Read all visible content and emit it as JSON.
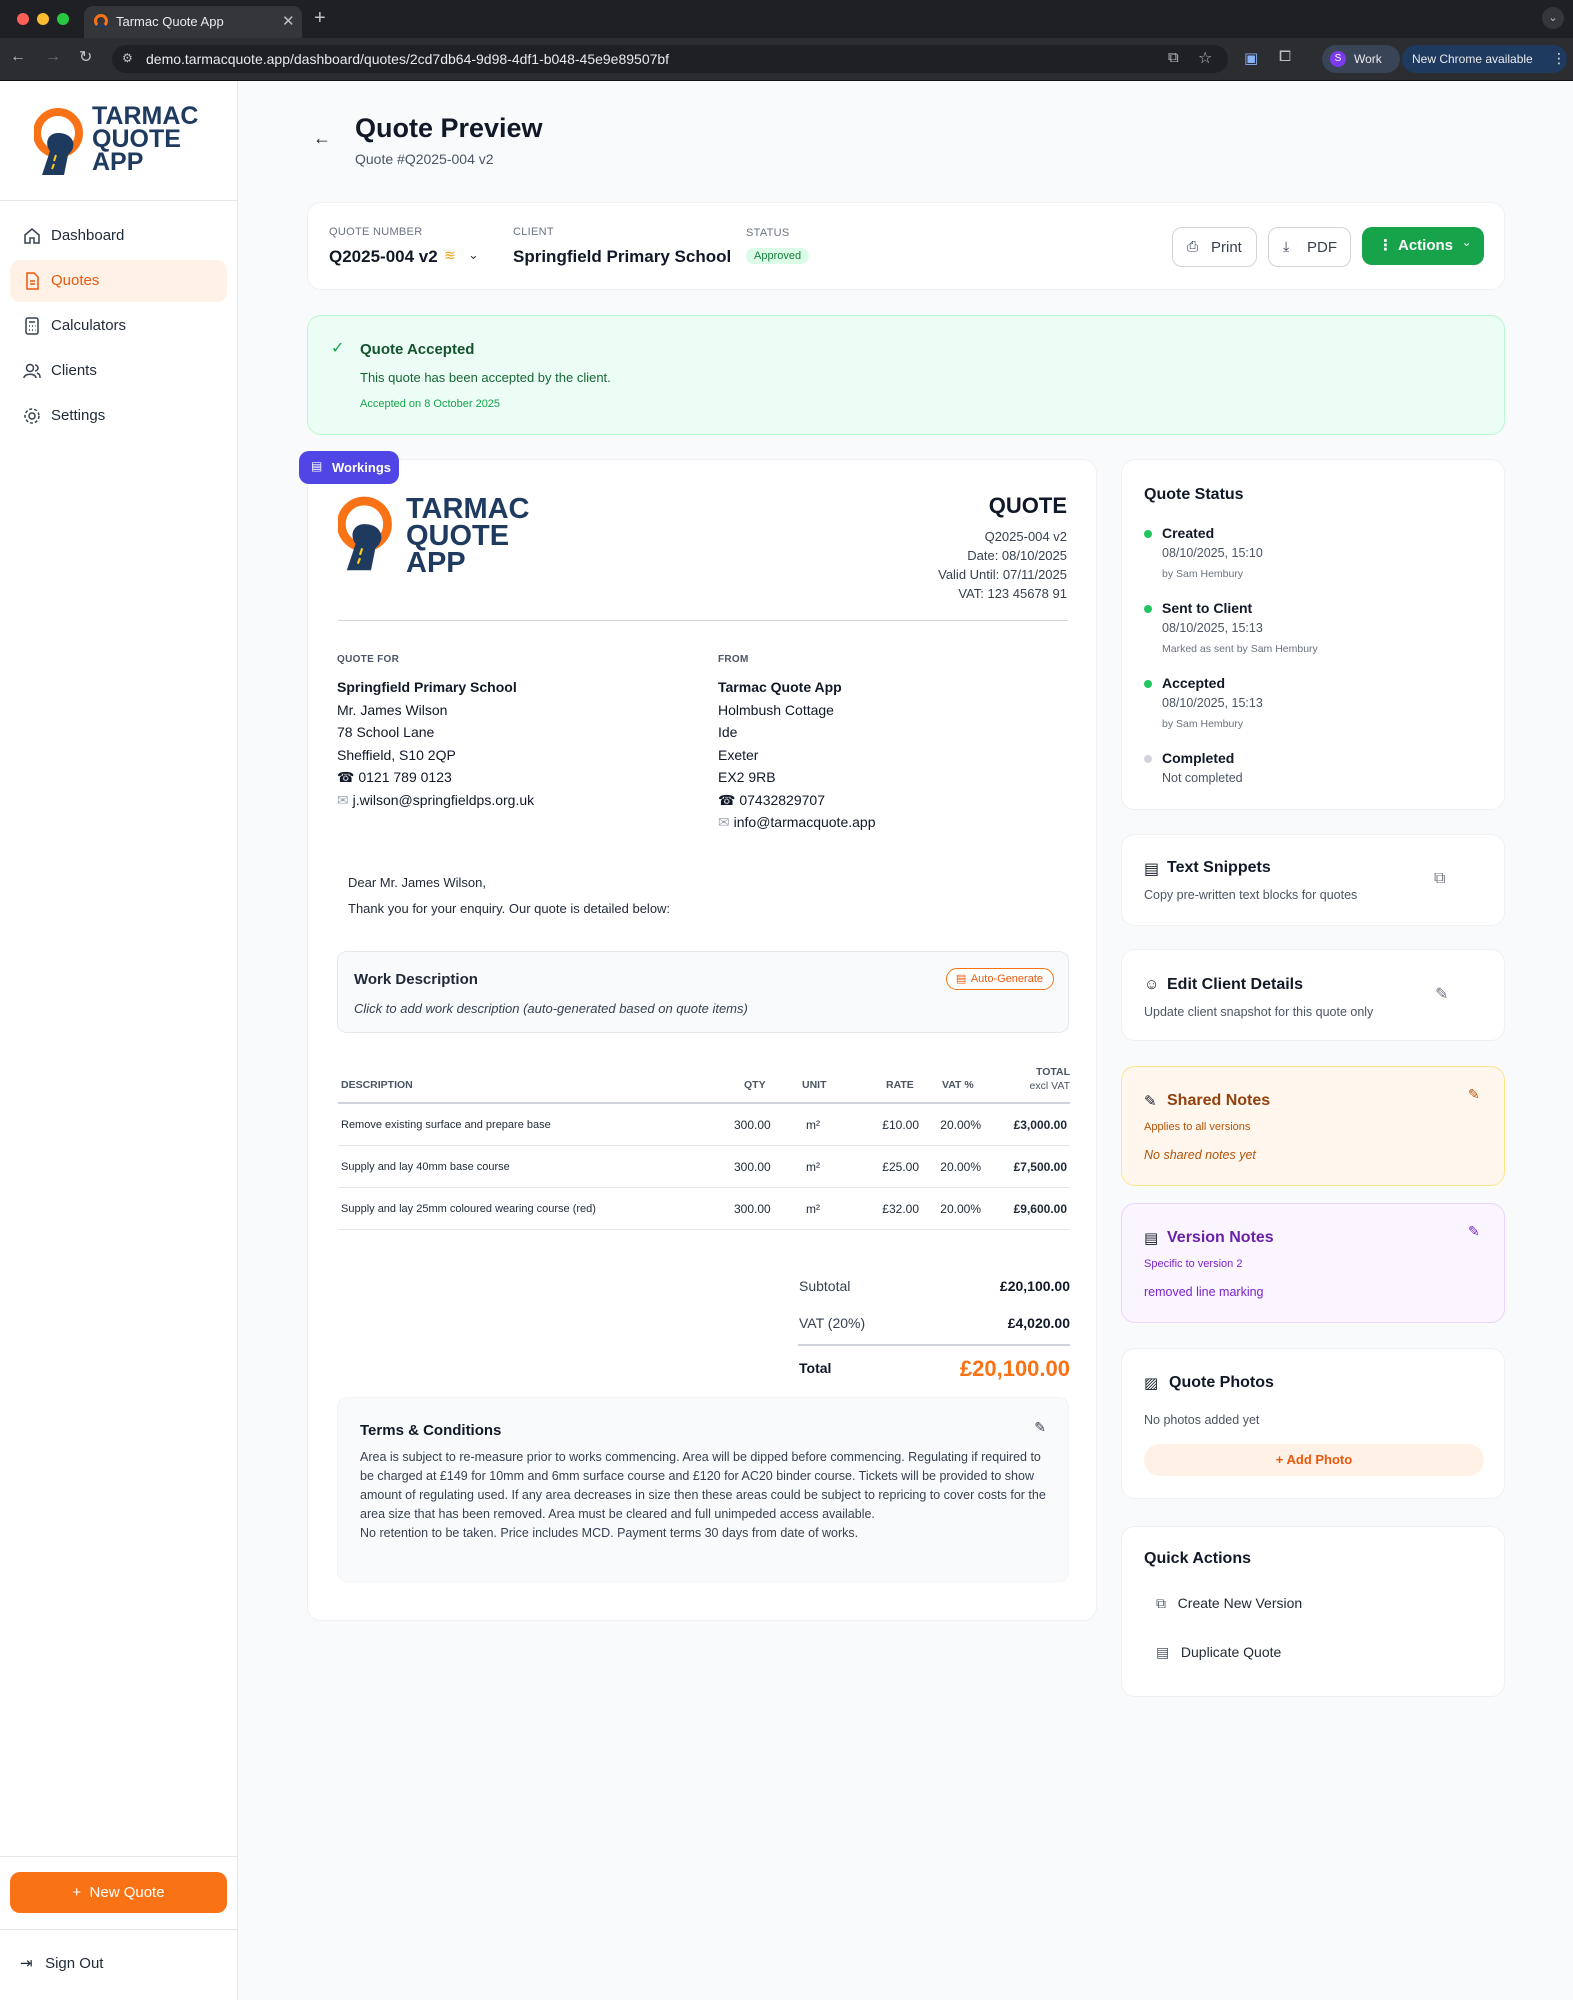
{
  "browser": {
    "tab_title": "Tarmac Quote App",
    "url": "demo.tarmacquote.app/dashboard/quotes/2cd7db64-9d98-4df1-b048-45e9e89507bf",
    "profile": "Work",
    "profile_initial": "S",
    "update_label": "New Chrome available"
  },
  "brand": {
    "line1": "TARMAC",
    "line2": "QUOTE",
    "line3": "APP",
    "primary_color": "#f97316",
    "dark_color": "#1e3a5f"
  },
  "sidebar": {
    "items": [
      {
        "label": "Dashboard",
        "icon": "home-icon"
      },
      {
        "label": "Quotes",
        "icon": "document-icon",
        "active": true
      },
      {
        "label": "Calculators",
        "icon": "calculator-icon"
      },
      {
        "label": "Clients",
        "icon": "users-icon"
      },
      {
        "label": "Settings",
        "icon": "gear-icon"
      }
    ],
    "new_quote": "New Quote",
    "sign_out": "Sign Out"
  },
  "header": {
    "title": "Quote Preview",
    "subtitle": "Quote #Q2025-004 v2"
  },
  "summary": {
    "quote_number_label": "QUOTE NUMBER",
    "quote_number": "Q2025-004 v2",
    "client_label": "CLIENT",
    "client": "Springfield Primary School",
    "status_label": "STATUS",
    "status": "Approved",
    "print": "Print",
    "pdf": "PDF",
    "actions": "Actions"
  },
  "accepted": {
    "title": "Quote Accepted",
    "message": "This quote has been accepted by the client.",
    "date": "Accepted on 8 October 2025"
  },
  "workings": "Workings",
  "document": {
    "heading": "QUOTE",
    "number": "Q2025-004 v2",
    "date": "Date: 08/10/2025",
    "valid_until": "Valid Until: 07/11/2025",
    "vat": "VAT: 123 45678 91",
    "quote_for_label": "QUOTE FOR",
    "quote_for": {
      "name": "Springfield Primary School",
      "contact": "Mr. James Wilson",
      "address1": "78 School Lane",
      "address2": "Sheffield, S10 2QP",
      "phone": "0121 789 0123",
      "email": "j.wilson@springfieldps.org.uk"
    },
    "from_label": "FROM",
    "from": {
      "name": "Tarmac Quote App",
      "line1": "Holmbush Cottage",
      "line2": "Ide",
      "line3": "Exeter",
      "line4": "EX2 9RB",
      "phone": "07432829707",
      "email": "info@tarmacquote.app"
    },
    "greeting": "Dear Mr. James Wilson,",
    "intro": "Thank you for your enquiry. Our quote is detailed below:",
    "work_title": "Work Description",
    "auto_generate": "Auto-Generate",
    "work_placeholder": "Click to add work description (auto-generated based on quote items)",
    "columns": {
      "description": "DESCRIPTION",
      "qty": "QTY",
      "unit": "UNIT",
      "rate": "RATE",
      "vat": "VAT %",
      "total": "TOTAL",
      "total_sub": "excl VAT"
    },
    "items": [
      {
        "description": "Remove existing surface and prepare base",
        "qty": "300.00",
        "unit": "m²",
        "rate": "£10.00",
        "vat": "20.00%",
        "total": "£3,000.00"
      },
      {
        "description": "Supply and lay 40mm base course",
        "qty": "300.00",
        "unit": "m²",
        "rate": "£25.00",
        "vat": "20.00%",
        "total": "£7,500.00"
      },
      {
        "description": "Supply and lay 25mm coloured wearing course (red)",
        "qty": "300.00",
        "unit": "m²",
        "rate": "£32.00",
        "vat": "20.00%",
        "total": "£9,600.00"
      }
    ],
    "subtotal_label": "Subtotal",
    "subtotal": "£20,100.00",
    "vat_label": "VAT (20%)",
    "vat_total": "£4,020.00",
    "total_label": "Total",
    "total": "£20,100.00",
    "terms_title": "Terms & Conditions",
    "terms_p1": "Area is subject to re-measure prior to works commencing. Area will be dipped before commencing. Regulating if required to be charged at £149 for 10mm and 6mm surface course and £120 for AC20 binder course. Tickets will be provided to show amount of regulating used. If any area decreases in size then these areas could be subject to repricing to cover costs for the area size that has been removed. Area must be cleared and full unimpeded access available.",
    "terms_p2": "No retention to be taken. Price includes MCD. Payment terms 30 days from date of works."
  },
  "quote_status": {
    "title": "Quote Status",
    "steps": [
      {
        "label": "Created",
        "time": "08/10/2025, 15:10",
        "by": "by Sam Hembury",
        "color": "#22c55e"
      },
      {
        "label": "Sent to Client",
        "time": "08/10/2025, 15:13",
        "by": "Marked as sent by Sam Hembury",
        "color": "#22c55e"
      },
      {
        "label": "Accepted",
        "time": "08/10/2025, 15:13",
        "by": "by Sam Hembury",
        "color": "#22c55e"
      },
      {
        "label": "Completed",
        "time": "Not completed",
        "by": "",
        "color": "#d1d5db"
      }
    ]
  },
  "snippets": {
    "title": "Text Snippets",
    "desc": "Copy pre-written text blocks for quotes"
  },
  "edit_client": {
    "title": "Edit Client Details",
    "desc": "Update client snapshot for this quote only"
  },
  "shared_notes": {
    "title": "Shared Notes",
    "sub": "Applies to all versions",
    "empty": "No shared notes yet"
  },
  "version_notes": {
    "title": "Version Notes",
    "sub": "Specific to version 2",
    "content": "removed line marking"
  },
  "photos": {
    "title": "Quote Photos",
    "empty": "No photos added yet",
    "add": "Add Photo"
  },
  "quick_actions": {
    "title": "Quick Actions",
    "create_version": "Create New Version",
    "duplicate": "Duplicate Quote"
  }
}
